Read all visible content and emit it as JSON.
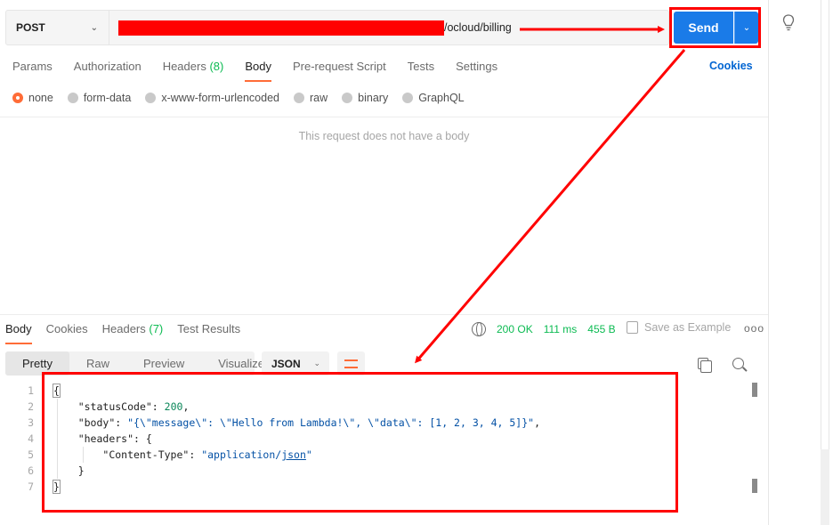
{
  "request": {
    "method": "POST",
    "url_visible": "/ocloud/billing",
    "send_label": "Send",
    "cookies_label": "Cookies"
  },
  "request_tabs": [
    {
      "label": "Params"
    },
    {
      "label": "Authorization"
    },
    {
      "label": "Headers",
      "count": "(8)"
    },
    {
      "label": "Body",
      "active": true
    },
    {
      "label": "Pre-request Script"
    },
    {
      "label": "Tests"
    },
    {
      "label": "Settings"
    }
  ],
  "body_types": [
    "none",
    "form-data",
    "x-www-form-urlencoded",
    "raw",
    "binary",
    "GraphQL"
  ],
  "body_type_selected": "none",
  "no_body_text": "This request does not have a body",
  "response": {
    "tabs": [
      {
        "label": "Body",
        "active": true
      },
      {
        "label": "Cookies"
      },
      {
        "label": "Headers",
        "count": "(7)"
      },
      {
        "label": "Test Results"
      }
    ],
    "status": "200 OK",
    "time": "111 ms",
    "size": "455 B",
    "save_example": "Save as Example",
    "more": "ooo",
    "views": [
      "Pretty",
      "Raw",
      "Preview",
      "Visualize"
    ],
    "active_view": "Pretty",
    "format": "JSON"
  },
  "code_lines": [
    {
      "n": "1"
    },
    {
      "n": "2"
    },
    {
      "n": "3"
    },
    {
      "n": "4"
    },
    {
      "n": "5"
    },
    {
      "n": "6"
    },
    {
      "n": "7"
    }
  ],
  "json_tokens": {
    "open": "{",
    "close": "}",
    "statusCode_key": "\"statusCode\"",
    "statusCode_val": "200",
    "body_key": "\"body\"",
    "body_val": "\"{\\\"message\\\": \\\"Hello from Lambda!\\\", \\\"data\\\": [1, 2, 3, 4, 5]}\"",
    "headers_key": "\"headers\"",
    "ct_key": "\"Content-Type\"",
    "ct_val_1": "\"application/",
    "ct_val_2": "json",
    "ct_val_3": "\""
  },
  "colors": {
    "accent": "#ff6c37",
    "send_blue": "#1a7be8",
    "status_green": "#0cbb52",
    "annotation_red": "#ff0000"
  }
}
